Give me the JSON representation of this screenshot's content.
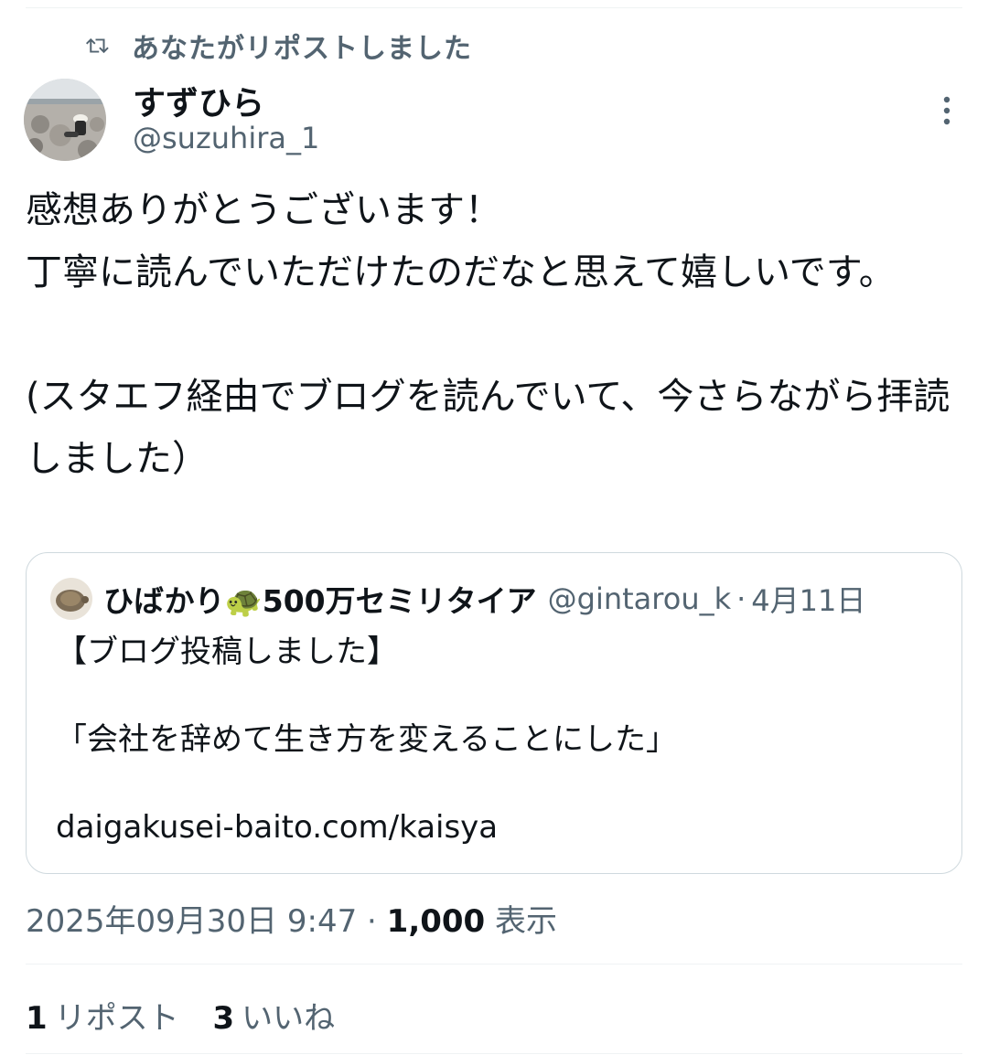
{
  "repost_banner": {
    "icon": "repost-icon",
    "text": "あなたがリポストしました"
  },
  "author": {
    "name": "すずひら",
    "handle": "@suzuhira_1"
  },
  "tweet": {
    "text": "感想ありがとうございます！\n丁寧に読んでいただけたのだなと思えて嬉しいです。\n\n(スタエフ経由でブログを読んでいて、今さらながら拝読しました）"
  },
  "quote": {
    "name": "ひばかり🐢500万セミリタイア",
    "handle": "@gintarou_k",
    "date": "4月11日",
    "text": "【ブログ投稿しました】\n\n「会社を辞めて生き方を変えることにした」\n\ndaigakusei-baito.com/kaisya"
  },
  "meta": {
    "timestamp": "2025年09月30日 9:47",
    "views_count": "1,000",
    "views_label": "表示"
  },
  "stats": {
    "reposts_count": "1",
    "reposts_label": "リポスト",
    "likes_count": "3",
    "likes_label": "いいね"
  },
  "colors": {
    "text": "#0f1419",
    "secondary": "#536471",
    "border": "#cfd9de"
  }
}
